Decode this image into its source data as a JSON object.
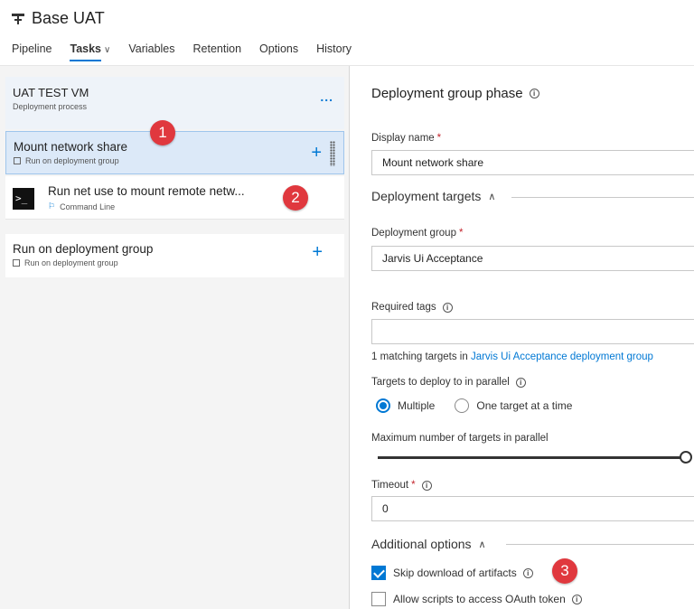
{
  "header": {
    "title": "Base UAT",
    "tabs": [
      {
        "label": "Pipeline"
      },
      {
        "label": "Tasks",
        "chevron": "∨"
      },
      {
        "label": "Variables"
      },
      {
        "label": "Retention"
      },
      {
        "label": "Options"
      },
      {
        "label": "History"
      }
    ]
  },
  "left": {
    "process": {
      "title": "UAT TEST VM",
      "subtitle": "Deployment process",
      "more": "..."
    },
    "phases": [
      {
        "name": "Mount network share",
        "subtitle": "Run on deployment group",
        "add": "+"
      },
      {
        "name": "Run on deployment group",
        "subtitle": "Run on deployment group",
        "add": "+"
      }
    ],
    "task": {
      "name": "Run net use to mount remote netw...",
      "subtitle": "Command Line",
      "icon_glyph": ">_"
    }
  },
  "callouts": [
    "1",
    "2",
    "3"
  ],
  "right": {
    "title": "Deployment group phase",
    "info_glyph": "i",
    "display_name": {
      "label": "Display name",
      "value": "Mount network share"
    },
    "deployment_targets": {
      "heading": "Deployment targets",
      "caret": "∧"
    },
    "deployment_group": {
      "label": "Deployment group",
      "value": "Jarvis Ui Acceptance"
    },
    "required_tags": {
      "label": "Required tags",
      "value": ""
    },
    "matching": {
      "prefix": "1 matching targets in ",
      "link": "Jarvis Ui Acceptance deployment group"
    },
    "parallel": {
      "label": "Targets to deploy to in parallel",
      "options": [
        "Multiple",
        "One target at a time"
      ],
      "selected": "Multiple"
    },
    "max_targets": {
      "label": "Maximum number of targets in parallel",
      "level": 1.0
    },
    "timeout": {
      "label": "Timeout",
      "value": "0"
    },
    "additional": {
      "heading": "Additional options",
      "caret": "∧"
    },
    "checkboxes": [
      {
        "label": "Skip download of artifacts",
        "checked": true
      },
      {
        "label": "Allow scripts to access OAuth token",
        "checked": false
      }
    ],
    "required_mark": "*"
  },
  "colors": {
    "accent": "#0078d4",
    "badge": "#e0383e",
    "selected_bg": "#dce9f8"
  },
  "icons": [
    "pipeline-icon",
    "more-icon",
    "add-icon",
    "drag-handle-icon",
    "command-line-icon",
    "deployment-group-icon",
    "info-icon",
    "caret-up-icon",
    "checkmark-icon"
  ]
}
